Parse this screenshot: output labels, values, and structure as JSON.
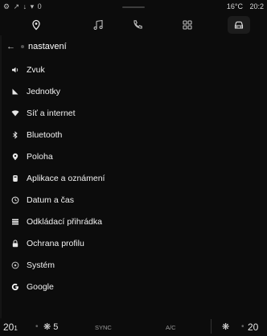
{
  "status": {
    "left_icons": "⚙ ↗ ↓ ▾ 0",
    "temp": "16°C",
    "time": "20:2"
  },
  "nav": {
    "icons": [
      "navigation-icon",
      "music-icon",
      "phone-icon",
      "apps-icon",
      "car-icon"
    ],
    "active": "car-icon"
  },
  "header": {
    "title": "nastavení"
  },
  "menu": [
    {
      "icon": "sound-icon",
      "label": "Zvuk"
    },
    {
      "icon": "units-icon",
      "label": "Jednotky"
    },
    {
      "icon": "wifi-icon",
      "label": "Síť a internet"
    },
    {
      "icon": "bluetooth-icon",
      "label": "Bluetooth"
    },
    {
      "icon": "location-icon",
      "label": "Poloha"
    },
    {
      "icon": "apps-notifications-icon",
      "label": "Aplikace a oznámení"
    },
    {
      "icon": "clock-icon",
      "label": "Datum a čas"
    },
    {
      "icon": "storage-icon",
      "label": "Odkládací přihrádka"
    },
    {
      "icon": "lock-icon",
      "label": "Ochrana profilu"
    },
    {
      "icon": "system-icon",
      "label": "Systém"
    },
    {
      "icon": "google-icon",
      "label": "Google"
    }
  ],
  "bottom": {
    "left_temp": "20",
    "left_temp_suffix": "1",
    "fan": "5",
    "sync": "SYNC",
    "ac": "A/C",
    "right_temp": "20"
  },
  "colors": {
    "background": "#0c0c0c",
    "text": "#f2f2f2",
    "muted": "#8a8a8a"
  }
}
